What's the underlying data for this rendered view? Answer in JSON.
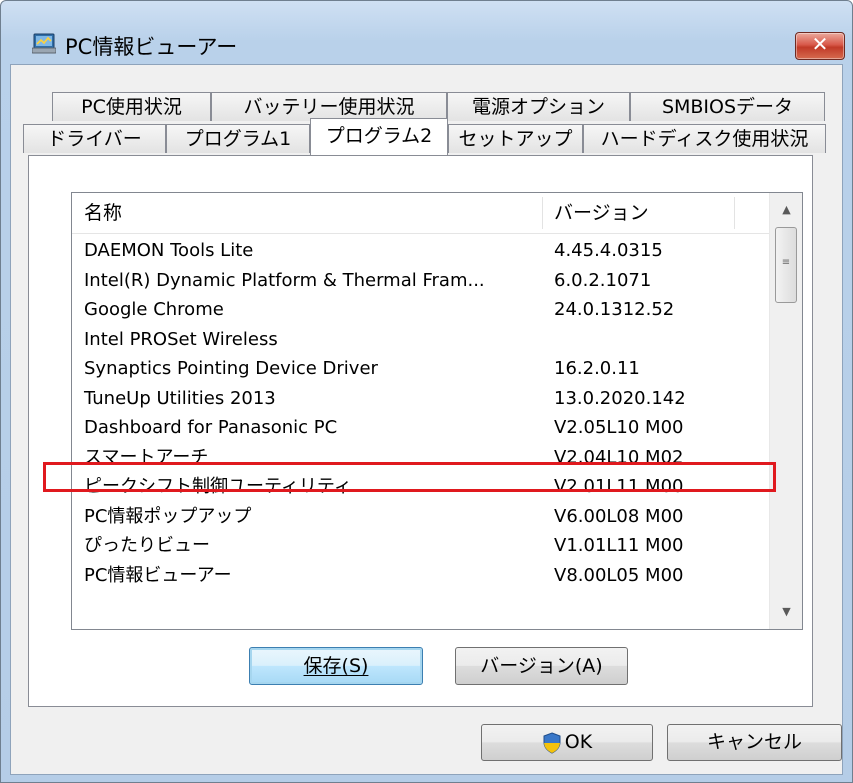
{
  "window": {
    "title": "PC情報ビューアー",
    "icon": "pc-info-app-icon",
    "close_label": "✕"
  },
  "tabs_row1": [
    {
      "label": "PC使用状況"
    },
    {
      "label": "バッテリー使用状況"
    },
    {
      "label": "電源オプション"
    },
    {
      "label": "SMBIOSデータ"
    }
  ],
  "tabs_row2": [
    {
      "label": "ドライバー"
    },
    {
      "label": "プログラム1"
    },
    {
      "label": "プログラム2",
      "active": true
    },
    {
      "label": "セットアップ"
    },
    {
      "label": "ハードディスク使用状況"
    }
  ],
  "list": {
    "columns": [
      "名称",
      "バージョン"
    ],
    "rows": [
      {
        "name": "DAEMON Tools Lite",
        "version": "4.45.4.0315"
      },
      {
        "name": "Intel(R) Dynamic Platform & Thermal Fram...",
        "version": "6.0.2.1071"
      },
      {
        "name": "Google Chrome",
        "version": "24.0.1312.52"
      },
      {
        "name": "Intel PROSet Wireless",
        "version": ""
      },
      {
        "name": "Synaptics Pointing Device Driver",
        "version": "16.2.0.11"
      },
      {
        "name": "TuneUp Utilities 2013",
        "version": "13.0.2020.142"
      },
      {
        "name": "Dashboard for Panasonic PC",
        "version": "V2.05L10 M00"
      },
      {
        "name": "スマートアーチ",
        "version": "V2.04L10 M02"
      },
      {
        "name": "ピークシフト制御ユーティリティ",
        "version": "V2.01L11 M00"
      },
      {
        "name": "PC情報ポップアップ",
        "version": "V6.00L08 M00"
      },
      {
        "name": "ぴったりビュー",
        "version": "V1.01L11 M00"
      },
      {
        "name": "PC情報ビューアー",
        "version": "V8.00L05 M00"
      }
    ],
    "highlighted_row": "スマートアーチ",
    "highlight_color": "#e0191e"
  },
  "buttons": {
    "save": "保存(S)",
    "version": "バージョン(A)",
    "ok": "OK",
    "cancel": "キャンセル"
  }
}
